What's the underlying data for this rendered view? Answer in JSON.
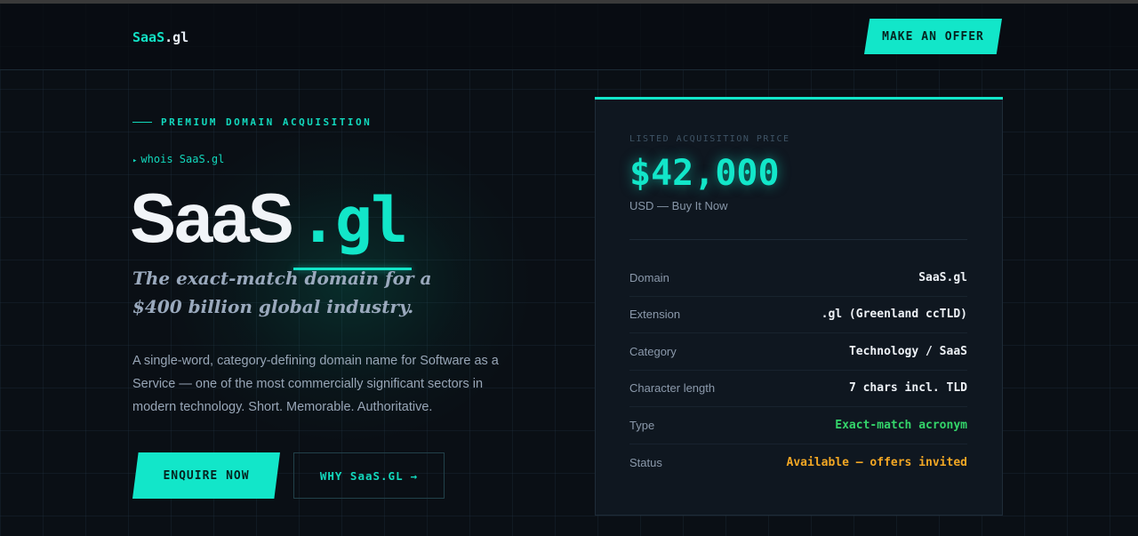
{
  "header": {
    "logo_brand": "SaaS",
    "logo_tld": ".gl",
    "offer_label": "MAKE AN OFFER"
  },
  "hero": {
    "eyebrow": "PREMIUM DOMAIN ACQUISITION",
    "whois": "whois SaaS.gl",
    "title_name": "SaaS",
    "title_tld": ".gl",
    "tagline": "The exact-match domain for a $400 billion global industry.",
    "description": "A single-word, category-defining domain name for Software as a Service — one of the most commercially significant sectors in modern technology. Short. Memorable. Authoritative.",
    "enquire_label": "ENQUIRE NOW",
    "why_label": "WHY SaaS.GL",
    "why_arrow": "→"
  },
  "card": {
    "price_label": "LISTED ACQUISITION PRICE",
    "price": "$42,000",
    "price_sub": "USD — Buy It Now",
    "rows": [
      {
        "key": "Domain",
        "value": "SaaS.gl"
      },
      {
        "key": "Extension",
        "value": ".gl (Greenland ccTLD)"
      },
      {
        "key": "Category",
        "value": "Technology / SaaS"
      },
      {
        "key": "Character length",
        "value": "7 chars incl. TLD"
      },
      {
        "key": "Type",
        "value": "Exact-match acronym"
      },
      {
        "key": "Status",
        "value": "Available — offers invited"
      }
    ]
  },
  "colors": {
    "accent": "#12e6c9",
    "background": "#0a0f15",
    "success": "#34d46a",
    "warning": "#f2a724"
  }
}
